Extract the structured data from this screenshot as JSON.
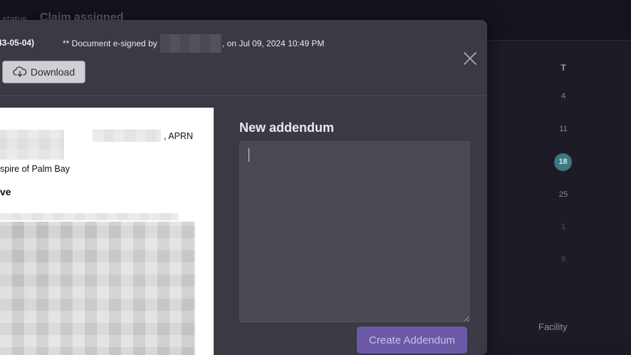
{
  "background": {
    "status_label": "t status",
    "status_value": "Claim assigned",
    "calendar": {
      "header": "T",
      "days": [
        "4",
        "11",
        "18",
        "25",
        "1",
        "8"
      ],
      "today": "18",
      "facility_label": "Facility"
    }
  },
  "modal": {
    "header": {
      "doc_id": "43-05-04)",
      "esign_prefix": "** Document e-signed by",
      "esign_suffix": ", on Jul 09, 2024 10:49 PM",
      "download_label": "Download"
    },
    "document": {
      "credential": ", APRN",
      "facility_line": "spire of Palm Bay",
      "heading": "ve"
    },
    "addendum": {
      "title": "New addendum",
      "value": "",
      "placeholder": "",
      "create_label": "Create Addendum"
    }
  },
  "colors": {
    "accent": "#6b58a6",
    "today_badge": "#3f7680",
    "modal_bg": "#3a3944"
  }
}
